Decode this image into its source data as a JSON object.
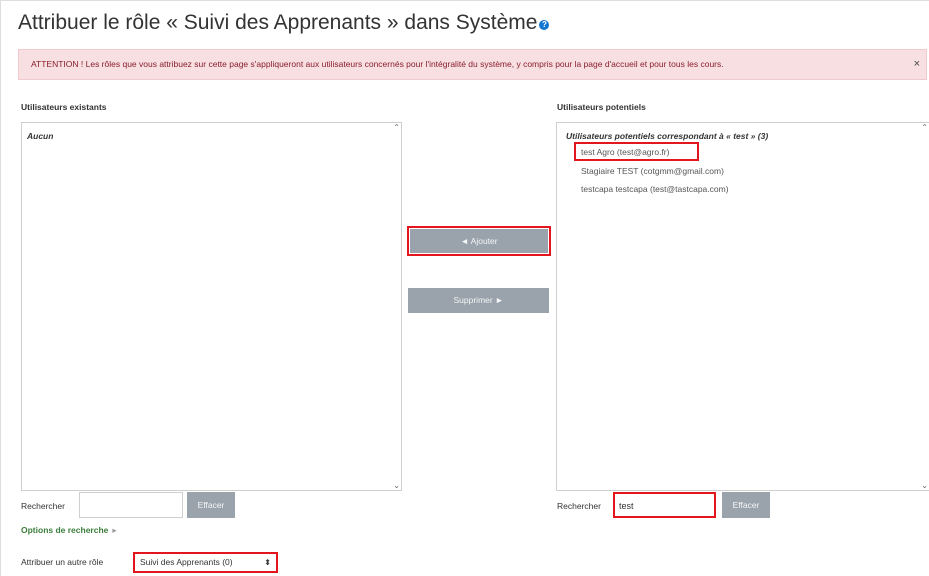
{
  "header": {
    "title": "Attribuer le rôle « Suivi des Apprenants » dans Système",
    "help_icon": "question-circle-icon"
  },
  "alert": {
    "text": "ATTENTION ! Les rôles que vous attribuez sur cette page s'appliqueront aux utilisateurs concernés pour l'intégralité du système, y compris pour la page d'accueil et pour tous les cours.",
    "close_label": "×"
  },
  "existing": {
    "heading": "Utilisateurs existants",
    "empty_label": "Aucun",
    "search_label": "Rechercher",
    "search_value": "",
    "clear_label": "Effacer"
  },
  "actions": {
    "add_label": "◄ Ajouter",
    "remove_label": "Supprimer ►"
  },
  "potential": {
    "heading": "Utilisateurs potentiels",
    "group_label": "Utilisateurs potentiels correspondant à « test » (3)",
    "users": [
      "test Agro (test@agro.fr)",
      "Stagiaire TEST (cotgmm@gmail.com)",
      "testcapa testcapa (test@tastcapa.com)"
    ],
    "search_label": "Rechercher",
    "search_value": "test",
    "clear_label": "Effacer"
  },
  "search_options": {
    "label": "Options de recherche",
    "arrow": "▸"
  },
  "other_role": {
    "label": "Attribuer un autre rôle",
    "selected": "Suivi des Apprenants (0)",
    "arrow": "⬍"
  },
  "colors": {
    "highlight": "#e3161e",
    "alert_bg": "#f7dfe2",
    "button_bg": "#9aa3ab",
    "link": "#3a7d3a"
  }
}
